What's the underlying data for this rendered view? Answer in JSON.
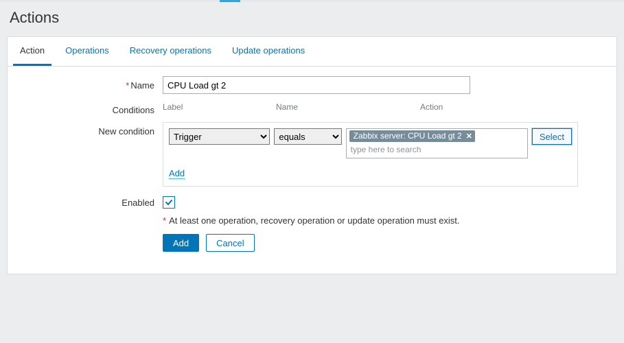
{
  "page_title": "Actions",
  "tabs": {
    "action": "Action",
    "operations": "Operations",
    "recovery": "Recovery operations",
    "update": "Update operations"
  },
  "form": {
    "name_label": "Name",
    "name_value": "CPU Load gt 2",
    "conditions_label": "Conditions",
    "cond_headers": {
      "label": "Label",
      "name": "Name",
      "action": "Action"
    },
    "newcond_label": "New condition",
    "newcond_type": "Trigger",
    "newcond_op": "equals",
    "newcond_tag": "Zabbix server: CPU Load gt 2",
    "newcond_placeholder": "type here to search",
    "select_btn": "Select",
    "add_link": "Add",
    "enabled_label": "Enabled",
    "enabled_checked": true,
    "hint": "At least one operation, recovery operation or update operation must exist.",
    "submit": "Add",
    "cancel": "Cancel"
  }
}
